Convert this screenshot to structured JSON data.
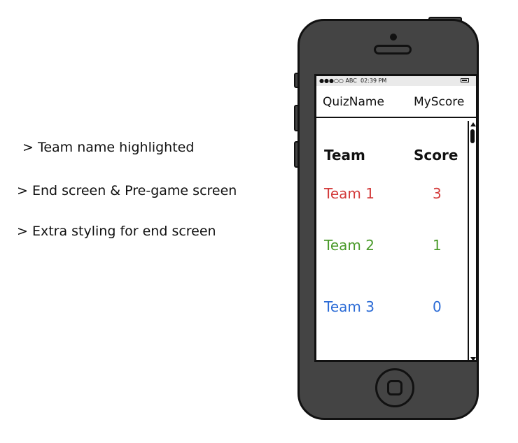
{
  "notes": [
    "> Team name highlighted",
    "> End screen & Pre-game screen",
    "> Extra styling for end screen"
  ],
  "phone": {
    "status_bar": {
      "carrier": "●●●○○ ABC",
      "time": "02:39 PM",
      "battery_icon": "battery-icon"
    },
    "nav": {
      "left_title": "QuizName",
      "right_title": "MyScore"
    },
    "table": {
      "headers": {
        "team": "Team",
        "score": "Score"
      },
      "rows": [
        {
          "team": "Team 1",
          "score": "3",
          "color": "#d33a3a"
        },
        {
          "team": "Team 2",
          "score": "1",
          "color": "#4a9a2a"
        },
        {
          "team": "Team 3",
          "score": "0",
          "color": "#2b6bd6"
        }
      ]
    },
    "colors": {
      "body": "#444444",
      "outline": "#111111",
      "screen": "#ffffff"
    }
  }
}
